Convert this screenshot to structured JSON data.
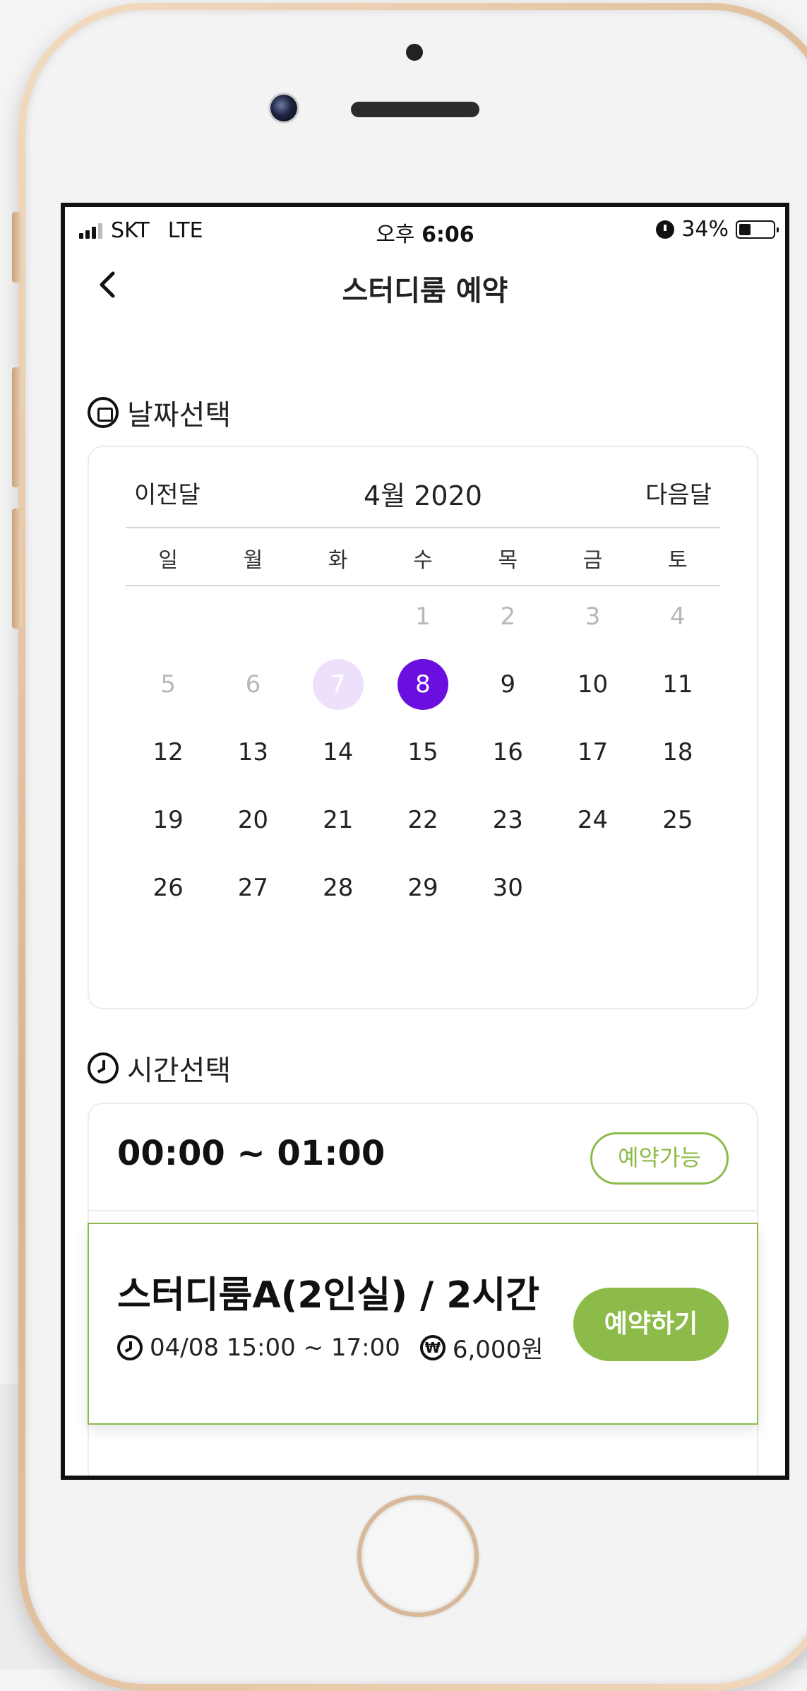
{
  "status_bar": {
    "carrier": "SKT",
    "network": "LTE",
    "time_prefix": "오후",
    "time": "6:06",
    "battery": "34%",
    "battery_level": 0.34
  },
  "nav": {
    "title": "스터디룸 예약"
  },
  "date_section": {
    "title": "날짜선택"
  },
  "calendar": {
    "prev_label": "이전달",
    "month_label": "4월 2020",
    "next_label": "다음달",
    "weekdays": [
      "일",
      "월",
      "화",
      "수",
      "목",
      "금",
      "토"
    ],
    "days": [
      {
        "label": "",
        "state": "empty"
      },
      {
        "label": "",
        "state": "empty"
      },
      {
        "label": "",
        "state": "empty"
      },
      {
        "label": "1",
        "state": "faded"
      },
      {
        "label": "2",
        "state": "faded"
      },
      {
        "label": "3",
        "state": "faded"
      },
      {
        "label": "4",
        "state": "faded"
      },
      {
        "label": "5",
        "state": "faded"
      },
      {
        "label": "6",
        "state": "faded"
      },
      {
        "label": "7",
        "state": "pale"
      },
      {
        "label": "8",
        "state": "selected"
      },
      {
        "label": "9",
        "state": "normal"
      },
      {
        "label": "10",
        "state": "normal"
      },
      {
        "label": "11",
        "state": "normal"
      },
      {
        "label": "12",
        "state": "normal"
      },
      {
        "label": "13",
        "state": "normal"
      },
      {
        "label": "14",
        "state": "normal"
      },
      {
        "label": "15",
        "state": "normal"
      },
      {
        "label": "16",
        "state": "normal"
      },
      {
        "label": "17",
        "state": "normal"
      },
      {
        "label": "18",
        "state": "normal"
      },
      {
        "label": "19",
        "state": "normal"
      },
      {
        "label": "20",
        "state": "normal"
      },
      {
        "label": "21",
        "state": "normal"
      },
      {
        "label": "22",
        "state": "normal"
      },
      {
        "label": "23",
        "state": "normal"
      },
      {
        "label": "24",
        "state": "normal"
      },
      {
        "label": "25",
        "state": "normal"
      },
      {
        "label": "26",
        "state": "normal"
      },
      {
        "label": "27",
        "state": "normal"
      },
      {
        "label": "28",
        "state": "normal"
      },
      {
        "label": "29",
        "state": "normal"
      },
      {
        "label": "30",
        "state": "normal"
      }
    ],
    "selected_color": "#6a0fe0"
  },
  "time_section": {
    "title": "시간선택",
    "slots": [
      {
        "time": "00:00 ~ 01:00",
        "status": "예약가능"
      }
    ]
  },
  "booking": {
    "room": "스터디룸A(2인실) / 2시간",
    "datetime": "04/08 15:00 ~ 17:00",
    "price": "6,000원",
    "button_label": "예약하기",
    "accent_color": "#8dbb49"
  }
}
